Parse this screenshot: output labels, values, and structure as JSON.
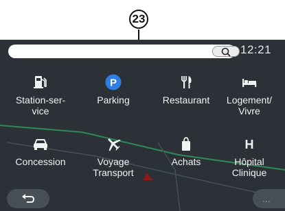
{
  "callout": {
    "number": "23"
  },
  "status": {
    "time": "12:21"
  },
  "search": {
    "placeholder": ""
  },
  "categories": [
    {
      "label": "Station-ser-\nvice",
      "icon": "fuel-pump-icon"
    },
    {
      "label": "Parking",
      "icon": "parking-icon"
    },
    {
      "label": "Restaurant",
      "icon": "fork-knife-icon"
    },
    {
      "label": "Logement/\nVivre",
      "icon": "bed-icon"
    },
    {
      "label": "Concession",
      "icon": "car-icon"
    },
    {
      "label": "Voyage\nTransport",
      "icon": "airplane-icon"
    },
    {
      "label": "Achats",
      "icon": "shopping-bag-icon"
    },
    {
      "label": "Hôpital\nClinique",
      "icon": "hospital-h-icon"
    }
  ],
  "footer": {
    "back_icon": "back-arrow-icon",
    "more_label": "..."
  },
  "colors": {
    "screen_bg": "#2b3137",
    "parking_badge": "#2f7de0",
    "map_route": "#2e8b57",
    "map_pin": "#8b1a1a"
  }
}
